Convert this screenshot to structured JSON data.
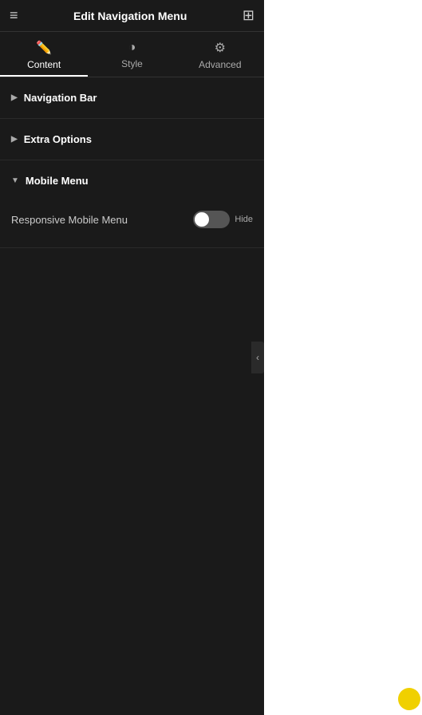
{
  "header": {
    "title": "Edit Navigation Menu",
    "hamburger_icon": "≡",
    "grid_icon": "⊞"
  },
  "tabs": [
    {
      "id": "content",
      "label": "Content",
      "icon": "✏️",
      "active": true
    },
    {
      "id": "style",
      "label": "Style",
      "icon": "◑",
      "active": false
    },
    {
      "id": "advanced",
      "label": "Advanced",
      "icon": "⚙",
      "active": false
    }
  ],
  "sections": [
    {
      "id": "navigation-bar",
      "label": "Navigation Bar",
      "expanded": false,
      "chevron": "▶"
    },
    {
      "id": "extra-options",
      "label": "Extra Options",
      "expanded": false,
      "chevron": "▶"
    },
    {
      "id": "mobile-menu",
      "label": "Mobile Menu",
      "expanded": true,
      "chevron": "▼",
      "fields": [
        {
          "id": "responsive-mobile-menu",
          "label": "Responsive Mobile Menu",
          "type": "toggle",
          "value": false,
          "toggle_text": "Hide"
        }
      ]
    }
  ],
  "collapse_btn": {
    "icon": "‹"
  }
}
